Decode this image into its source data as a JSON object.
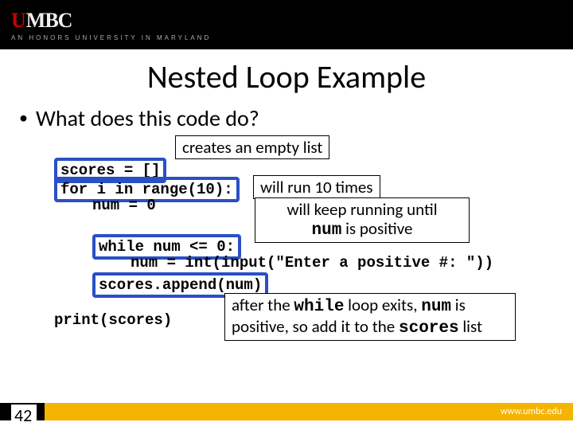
{
  "brand": {
    "logo_u": "U",
    "logo_mbc": "MBC",
    "tagline": "AN HONORS UNIVERSITY IN MARYLAND"
  },
  "slide": {
    "title": "Nested Loop Example",
    "bullet": "What does this code do?",
    "page_number": "42"
  },
  "code": {
    "line1": "scores = []",
    "line2": "for i in range(10):",
    "line3": "num = 0",
    "line4": "while num <= 0:",
    "line5": "num = int(input(\"Enter a positive #: \"))",
    "line6": "scores.append(num)",
    "line7": "print(scores)"
  },
  "annotations": {
    "a1": "creates an empty list",
    "a2": "will run 10 times",
    "a3_line1": "will keep running until",
    "a3_num": "num",
    "a3_line2_rest": " is positive",
    "a4_part1": "after the ",
    "a4_while": "while",
    "a4_part2": " loop exits, ",
    "a4_num": "num",
    "a4_part3": " is positive, so add it to the ",
    "a4_scores": "scores",
    "a4_part4": " list"
  },
  "footer": {
    "url": "www.umbc.edu"
  }
}
